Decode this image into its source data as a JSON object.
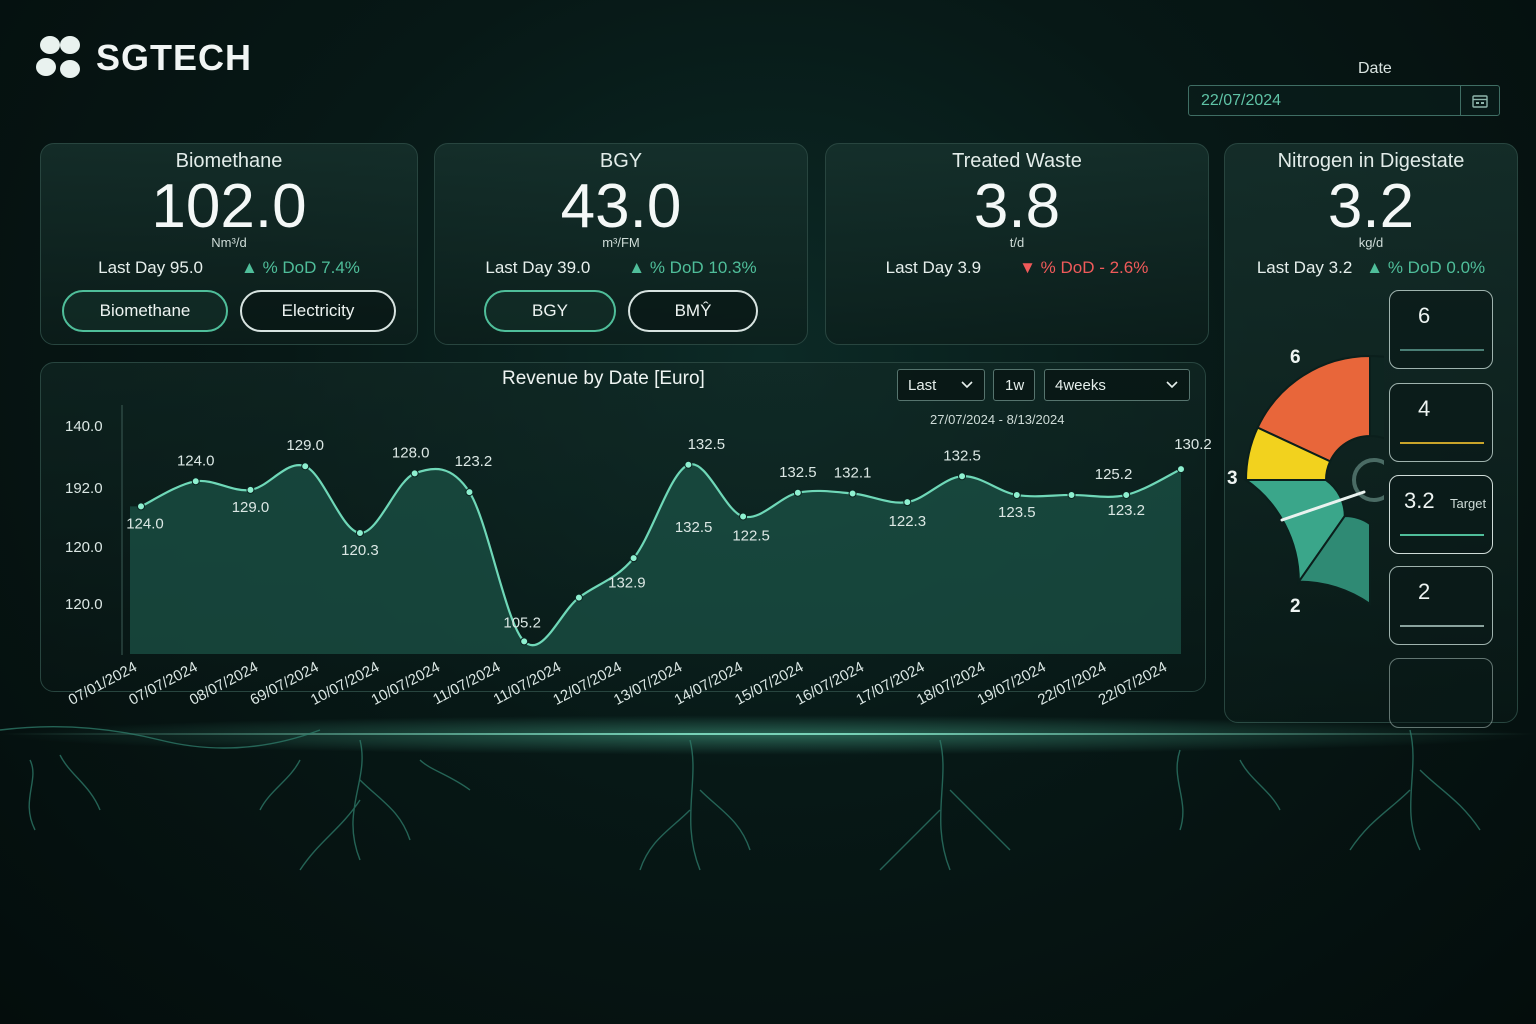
{
  "brand": {
    "name": "SGTECH"
  },
  "date": {
    "label": "Date",
    "value": "22/07/2024"
  },
  "cards": [
    {
      "title": "Biomethane",
      "value": "102.0",
      "unit": "Nm³/d",
      "last_day": "Last Day 95.0",
      "dod": "▲ % DoD  7.4%",
      "trend": "up",
      "buttons": [
        "Biomethane",
        "Electricity"
      ]
    },
    {
      "title": "BGY",
      "value": "43.0",
      "unit": "m³/FM",
      "last_day": "Last Day 39.0",
      "dod": "▲ % DoD  10.3%",
      "trend": "up",
      "buttons": [
        "BGY",
        "BMŶ"
      ]
    },
    {
      "title": "Treated Waste",
      "value": "3.8",
      "unit": "t/d",
      "last_day": "Last Day 3.9",
      "dod": "▼ % DoD - 2.6%",
      "trend": "down"
    }
  ],
  "nitrogen": {
    "title": "Nitrogen in Digestate",
    "value": "3.2",
    "unit": "kg/d",
    "last_day": "Last Day 3.2",
    "dod": "▲ % DoD  0.0%",
    "trend": "up",
    "gauge_labels": [
      "6",
      "3",
      "2"
    ],
    "gauge_value": 3.2,
    "levels": [
      {
        "value": "6",
        "target": "",
        "line_color": "#4a7f75"
      },
      {
        "value": "4",
        "target": "",
        "line_color": "#c9a42a"
      },
      {
        "value": "3.2",
        "target": "Target",
        "line_color": "#4fbe9a"
      },
      {
        "value": "2",
        "target": "",
        "line_color": "#8aa29d"
      },
      {
        "value": "",
        "target": "",
        "line_color": ""
      }
    ],
    "colors": {
      "orange": "#e8663a",
      "yellow": "#f2d21e",
      "teal": "#3aa68a",
      "teal_dark": "#2f8a74"
    }
  },
  "chart_controls": {
    "period": "Last",
    "unit_button": "1w",
    "range": "4weeks",
    "range_text": "27/07/2024 - 8/13/2024"
  },
  "chart_data": {
    "type": "area",
    "title": "Revenue by Date [Euro]",
    "y_tick_labels": [
      "140.0",
      "192.0",
      "120.0",
      "120.0"
    ],
    "x_tick_labels": [
      "07/01/2024",
      "07/07/2024",
      "08/07/2024",
      "69/07/2024",
      "10/07/2024",
      "10/07/2024",
      "11/07/2024",
      "11/07/2024",
      "12/07/2024",
      "13/07/2024",
      "14/07/2024",
      "15/07/2024",
      "16/07/2024",
      "17/07/2024",
      "18/07/2024",
      "19/07/2024",
      "22/07/2024",
      "22/07/2024"
    ],
    "points": [
      {
        "label": "124.0",
        "value": 124.0
      },
      {
        "label": "124.0",
        "value": 127.5
      },
      {
        "label": "129.0",
        "value": 126.3
      },
      {
        "label": "129.0",
        "value": 129.6
      },
      {
        "label": "120.3",
        "value": 120.3
      },
      {
        "label": "128.0",
        "value": 128.6
      },
      {
        "label": "123.2",
        "value": 126.0
      },
      {
        "label": "105.2",
        "value": 105.2
      },
      {
        "label": "132.9",
        "value": 111.3
      },
      {
        "label": "132.5",
        "value": 116.8
      },
      {
        "label": "132.5",
        "value": 129.8
      },
      {
        "label": "122.5",
        "value": 122.6
      },
      {
        "label": "132.5",
        "value": 125.9
      },
      {
        "label": "132.1",
        "value": 125.8
      },
      {
        "label": "122.3",
        "value": 124.6
      },
      {
        "label": "132.5",
        "value": 128.2
      },
      {
        "label": "123.5",
        "value": 125.6
      },
      {
        "label": "125.2",
        "value": 125.6
      },
      {
        "label": "123.2",
        "value": 125.6
      },
      {
        "label": "130.2",
        "value": 129.2
      }
    ],
    "ylim": [
      104,
      132
    ],
    "grid": false,
    "colors": {
      "line": "#6fd8b8",
      "fill": "#1b5246"
    }
  }
}
